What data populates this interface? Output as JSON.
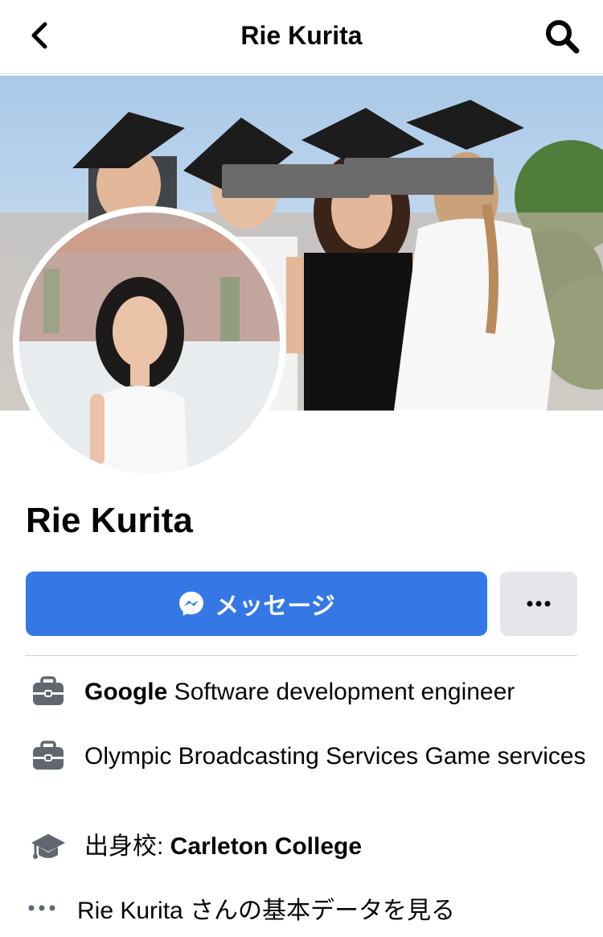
{
  "header": {
    "title": "Rie Kurita"
  },
  "profile": {
    "name": "Rie Kurita"
  },
  "actions": {
    "message_label": "メッセージ"
  },
  "details": [
    {
      "bold": "Google",
      "text": " Software development engineer"
    },
    {
      "text": "Olympic Broadcasting Services Game services"
    },
    {
      "prefix": "出身校: ",
      "bold": "Carleton College"
    },
    {
      "text": "Rie Kurita さんの基本データを見る"
    }
  ],
  "colors": {
    "primary": "#3578e5",
    "secondary_btn": "#e4e6eb",
    "icon": "#606770"
  }
}
